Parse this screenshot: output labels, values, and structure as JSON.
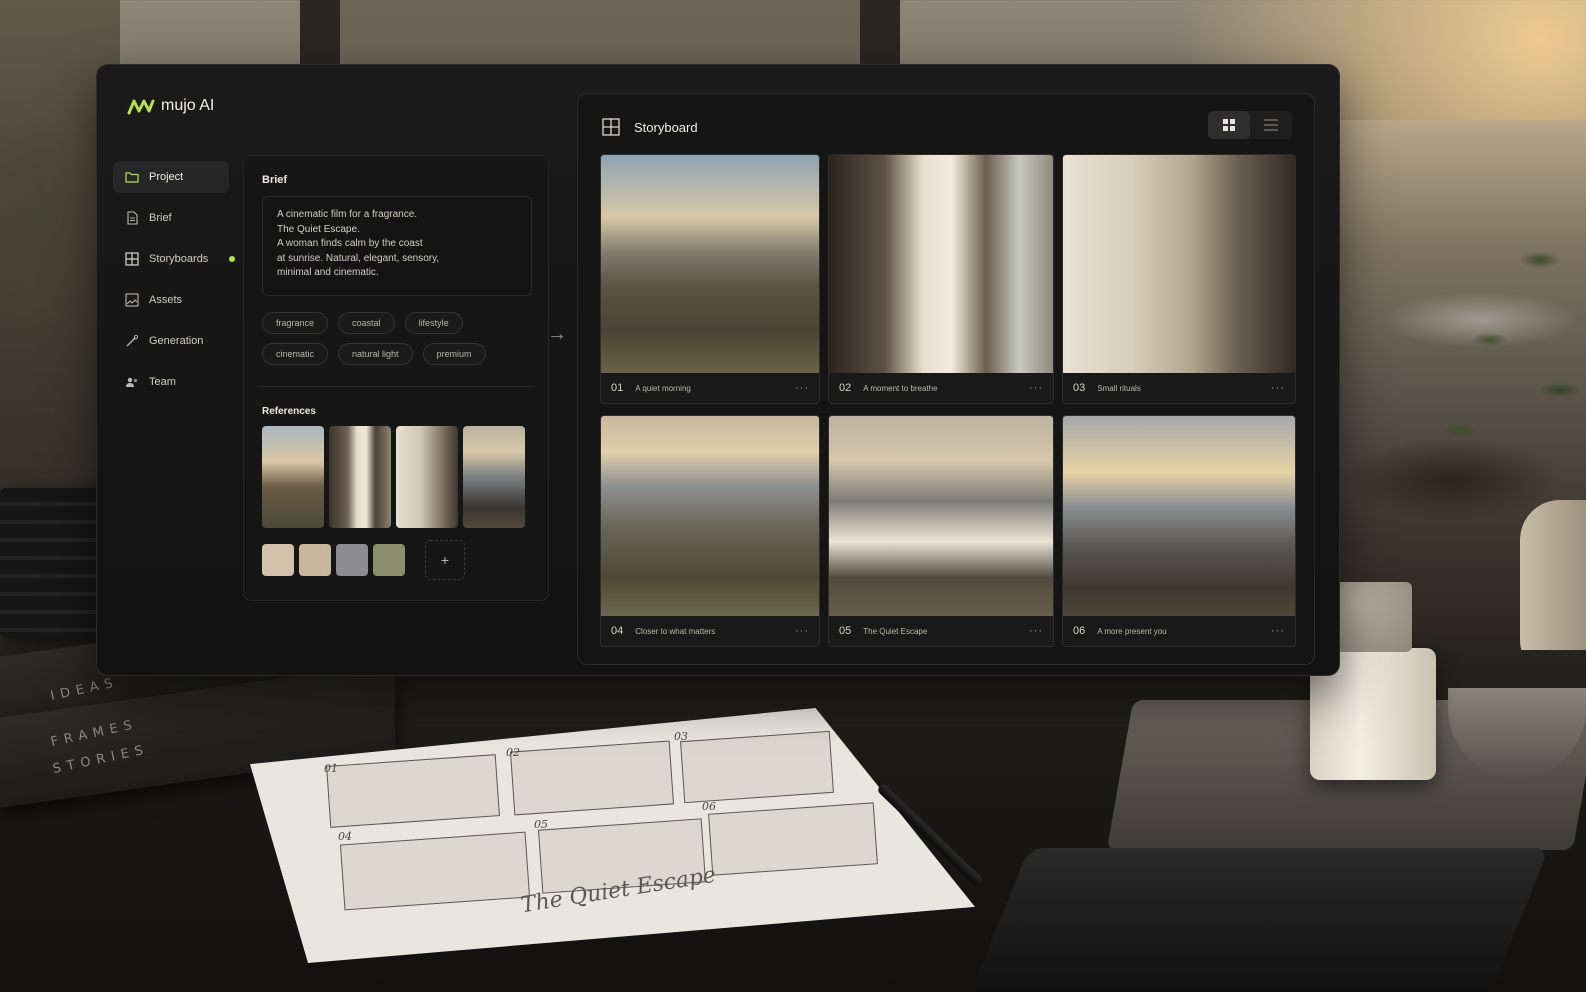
{
  "app": {
    "name": "mujo AI",
    "accent": "#b7df4a"
  },
  "nav": {
    "items": [
      {
        "label": "Project",
        "icon": "folder-icon",
        "active": true
      },
      {
        "label": "Brief",
        "icon": "document-icon"
      },
      {
        "label": "Storyboards",
        "icon": "grid-icon",
        "status_dot": true
      },
      {
        "label": "Assets",
        "icon": "image-icon"
      },
      {
        "label": "Generation",
        "icon": "wand-icon"
      },
      {
        "label": "Team",
        "icon": "team-icon"
      }
    ]
  },
  "brief": {
    "title": "Brief",
    "text": "A cinematic film for a fragrance.\nThe Quiet Escape.\nA woman finds calm by the coast\nat sunrise.  Natural, elegant, sensory,\nminimal and cinematic.",
    "tags": [
      "fragrance",
      "coastal",
      "lifestyle",
      "cinematic",
      "natural light",
      "premium"
    ],
    "references_title": "References",
    "swatch_colors": [
      "#d3c2aa",
      "#c9b79c",
      "#8d8d8f",
      "#8b8d6c"
    ],
    "add_label": "+"
  },
  "storyboard": {
    "title": "Storyboard",
    "frames": [
      {
        "num": "01",
        "caption": "A quiet morning"
      },
      {
        "num": "02",
        "caption": "A moment to breathe"
      },
      {
        "num": "03",
        "caption": "Small rituals"
      },
      {
        "num": "04",
        "caption": "Closer to what matters"
      },
      {
        "num": "05",
        "caption": "The Quiet Escape"
      },
      {
        "num": "06",
        "caption": "A more present you"
      }
    ],
    "more_label": "···"
  },
  "scene": {
    "books": [
      "IDEAS",
      "FRAMES",
      "STORIES"
    ],
    "sketch_numbers": [
      "01",
      "02",
      "03",
      "04",
      "05",
      "06"
    ],
    "script_text": "The Quiet Escape"
  }
}
